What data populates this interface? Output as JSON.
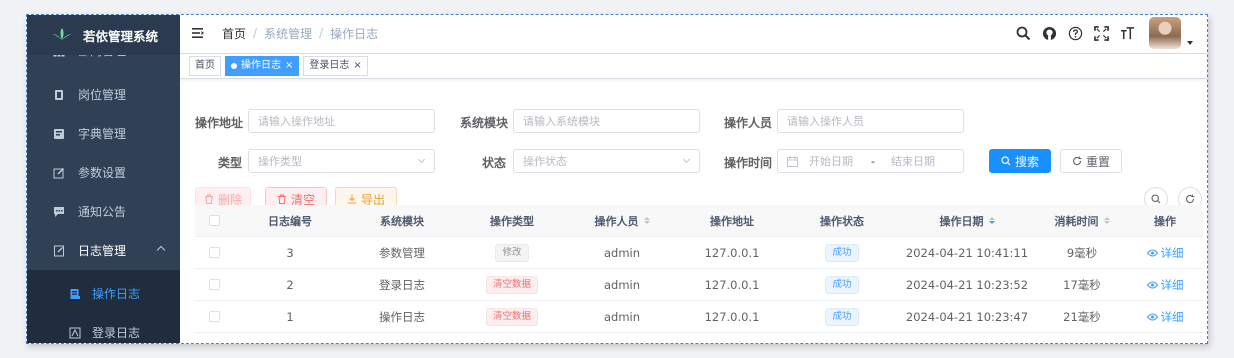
{
  "app": {
    "title": "若依管理系统"
  },
  "sidebar": {
    "items": [
      {
        "label": "部门管理",
        "icon": "tree-icon"
      },
      {
        "label": "岗位管理",
        "icon": "post-icon"
      },
      {
        "label": "字典管理",
        "icon": "dict-icon"
      },
      {
        "label": "参数设置",
        "icon": "edit-icon"
      },
      {
        "label": "通知公告",
        "icon": "message-icon"
      },
      {
        "label": "日志管理",
        "icon": "log-icon"
      }
    ],
    "log_submenu": [
      {
        "label": "操作日志",
        "icon": "form-icon",
        "active": true
      },
      {
        "label": "登录日志",
        "icon": "logininfor-icon",
        "active": false
      }
    ]
  },
  "navbar": {
    "breadcrumb": [
      "首页",
      "/",
      "系统管理",
      "/",
      "操作日志"
    ],
    "icons": [
      "search-icon",
      "github-icon",
      "question-icon",
      "fullscreen-icon",
      "font-size-icon"
    ]
  },
  "tags": [
    {
      "label": "首页",
      "active": false,
      "closable": false
    },
    {
      "label": "操作日志",
      "active": true,
      "closable": true
    },
    {
      "label": "登录日志",
      "active": false,
      "closable": true
    }
  ],
  "tag_close": "×",
  "search": {
    "oper_ip": {
      "label": "操作地址",
      "placeholder": "请输入操作地址"
    },
    "title": {
      "label": "系统模块",
      "placeholder": "请输入系统模块"
    },
    "oper_name": {
      "label": "操作人员",
      "placeholder": "请输入操作人员"
    },
    "type": {
      "label": "类型",
      "placeholder": "操作类型"
    },
    "status": {
      "label": "状态",
      "placeholder": "操作状态"
    },
    "oper_time": {
      "label": "操作时间",
      "start": "开始日期",
      "sep": "-",
      "end": "结束日期"
    },
    "search_btn": "搜索",
    "reset_btn": "重置"
  },
  "toolbar": {
    "delete": "删除",
    "clean": "清空",
    "export": "导出"
  },
  "table": {
    "columns": [
      "日志编号",
      "系统模块",
      "操作类型",
      "操作人员",
      "操作地址",
      "操作状态",
      "操作日期",
      "消耗时间",
      "操作"
    ],
    "rows": [
      {
        "id": "3",
        "module": "参数管理",
        "type": "修改",
        "type_style": "info",
        "operator": "admin",
        "ip": "127.0.0.1",
        "status": "成功",
        "date": "2024-04-21 10:41:11",
        "cost": "9毫秒",
        "action": "详细"
      },
      {
        "id": "2",
        "module": "登录日志",
        "type": "清空数据",
        "type_style": "danger",
        "operator": "admin",
        "ip": "127.0.0.1",
        "status": "成功",
        "date": "2024-04-21 10:23:52",
        "cost": "17毫秒",
        "action": "详细"
      },
      {
        "id": "1",
        "module": "操作日志",
        "type": "清空数据",
        "type_style": "danger",
        "operator": "admin",
        "ip": "127.0.0.1",
        "status": "成功",
        "date": "2024-04-21 10:23:47",
        "cost": "21毫秒",
        "action": "详细"
      }
    ]
  },
  "colors": {
    "sidebar_bg": "#304156",
    "primary": "#409eff",
    "danger": "#f56c6c",
    "warning": "#e6a23c"
  }
}
